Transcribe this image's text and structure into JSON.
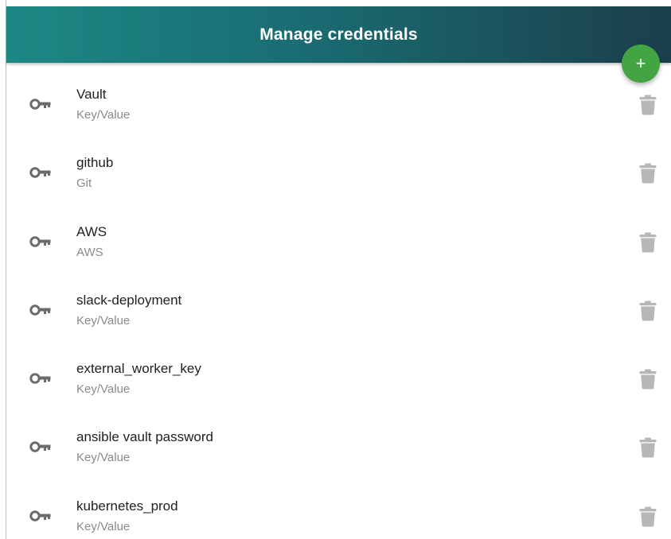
{
  "header": {
    "title": "Manage credentials"
  },
  "fab": {
    "label": "+"
  },
  "icons": {
    "row_icon": "key-icon",
    "delete_icon": "trash-icon",
    "icon_color": "#6b6b6b",
    "trash_color": "#b7b7b7",
    "fab_color": "#43a443"
  },
  "credentials": [
    {
      "name": "Vault",
      "type": "Key/Value"
    },
    {
      "name": "github",
      "type": "Git"
    },
    {
      "name": "AWS",
      "type": "AWS"
    },
    {
      "name": "slack-deployment",
      "type": "Key/Value"
    },
    {
      "name": "external_worker_key",
      "type": "Key/Value"
    },
    {
      "name": "ansible vault password",
      "type": "Key/Value"
    },
    {
      "name": "kubernetes_prod",
      "type": "Key/Value"
    }
  ]
}
